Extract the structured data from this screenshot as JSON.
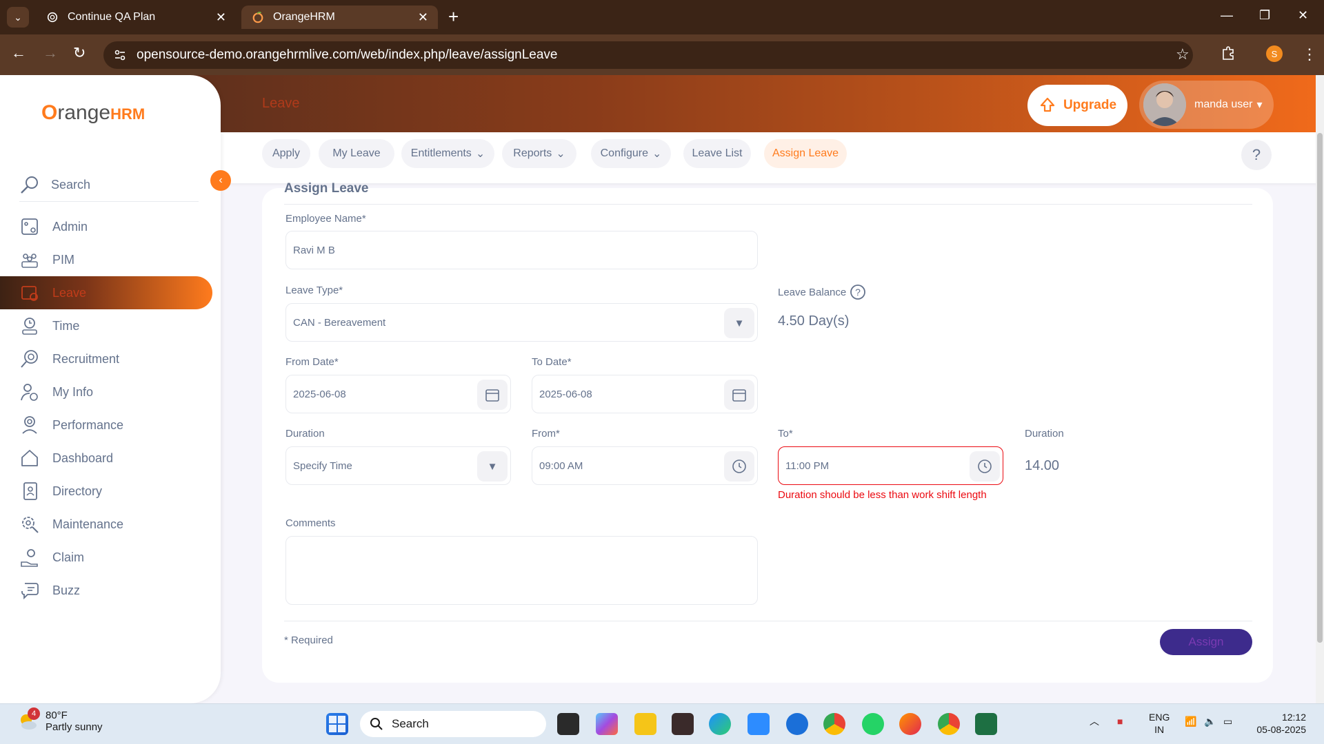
{
  "browser": {
    "tabs": [
      {
        "title": "Continue QA Plan",
        "active": false
      },
      {
        "title": "OrangeHRM",
        "active": true
      }
    ],
    "url": "opensource-demo.orangehrmlive.com/web/index.php/leave/assignLeave",
    "profile_initial": "S",
    "icons": [
      "tab-search-icon",
      "new-tab-icon",
      "minimize-icon",
      "maximize-icon",
      "close-icon",
      "back-icon",
      "forward-icon",
      "reload-icon",
      "site-info-icon",
      "bookmark-star-icon",
      "extensions-icon",
      "menu-kebab-icon"
    ]
  },
  "app": {
    "logo_text_main": "range",
    "logo_text_o": "O",
    "logo_text_hrm": "HRM",
    "page_title": "Leave",
    "upgrade_label": "Upgrade",
    "user_name": "manda user",
    "accent_color": "#ff7b1d",
    "error_color": "#eb0910"
  },
  "sidebar": {
    "search_label": "Search",
    "items": [
      {
        "label": "Admin",
        "icon": "admin-icon"
      },
      {
        "label": "PIM",
        "icon": "pim-icon"
      },
      {
        "label": "Leave",
        "icon": "leave-icon",
        "active": true
      },
      {
        "label": "Time",
        "icon": "time-icon"
      },
      {
        "label": "Recruitment",
        "icon": "recruitment-icon"
      },
      {
        "label": "My Info",
        "icon": "myinfo-icon"
      },
      {
        "label": "Performance",
        "icon": "performance-icon"
      },
      {
        "label": "Dashboard",
        "icon": "dashboard-icon"
      },
      {
        "label": "Directory",
        "icon": "directory-icon"
      },
      {
        "label": "Maintenance",
        "icon": "maintenance-icon"
      },
      {
        "label": "Claim",
        "icon": "claim-icon"
      },
      {
        "label": "Buzz",
        "icon": "buzz-icon"
      }
    ]
  },
  "subnav": {
    "items": [
      {
        "label": "Apply",
        "dropdown": false
      },
      {
        "label": "My Leave",
        "dropdown": false
      },
      {
        "label": "Entitlements",
        "dropdown": true
      },
      {
        "label": "Reports",
        "dropdown": true
      },
      {
        "label": "Configure",
        "dropdown": true
      },
      {
        "label": "Leave List",
        "dropdown": false
      },
      {
        "label": "Assign Leave",
        "dropdown": false,
        "active": true
      }
    ],
    "help_label": "?"
  },
  "form": {
    "title": "Assign Leave",
    "employee_name_label": "Employee Name*",
    "employee_name_value": "Ravi M B",
    "leave_type_label": "Leave Type*",
    "leave_type_value": "CAN - Bereavement",
    "leave_balance_label": "Leave Balance",
    "leave_balance_value": "4.50 Day(s)",
    "from_date_label": "From Date*",
    "from_date_value": "2025-06-08",
    "to_date_label": "To Date*",
    "to_date_value": "2025-06-08",
    "duration_label": "Duration",
    "duration_value": "Specify Time",
    "from_time_label": "From*",
    "from_time_value": "09:00 AM",
    "to_time_label": "To*",
    "to_time_value": "11:00 PM",
    "to_time_error": "Duration should be less than work shift length",
    "duration_hours_label": "Duration",
    "duration_hours_value": "14.00",
    "comments_label": "Comments",
    "comments_value": "",
    "required_note": "* Required",
    "assign_label": "Assign"
  },
  "taskbar": {
    "weather_temp": "80°F",
    "weather_desc": "Partly sunny",
    "weather_badge": "4",
    "search_label": "Search",
    "lang_top": "ENG",
    "lang_bottom": "IN",
    "time": "12:12",
    "date": "05-08-2025"
  }
}
